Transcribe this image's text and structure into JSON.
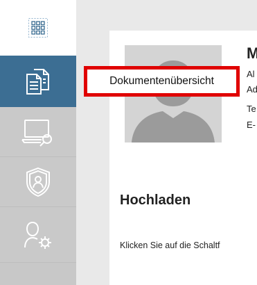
{
  "sidebar": {
    "items": [
      {
        "name": "apps-grid",
        "icon": "grid-icon"
      },
      {
        "name": "documents",
        "icon": "documents-icon",
        "active": true
      },
      {
        "name": "it-service",
        "icon": "laptop-wrench-icon"
      },
      {
        "name": "security",
        "icon": "shield-user-icon"
      },
      {
        "name": "user-settings",
        "icon": "user-gear-icon"
      }
    ],
    "active_color": "#3c6e93"
  },
  "tooltip": {
    "label": "Dokumentenübersicht",
    "border_color": "#e00000"
  },
  "profile": {
    "name_partial": "M",
    "lines": [
      "Al",
      "Ad",
      "Te",
      "E-"
    ]
  },
  "upload": {
    "title": "Hochladen",
    "text": "Klicken Sie auf die Schaltf"
  }
}
